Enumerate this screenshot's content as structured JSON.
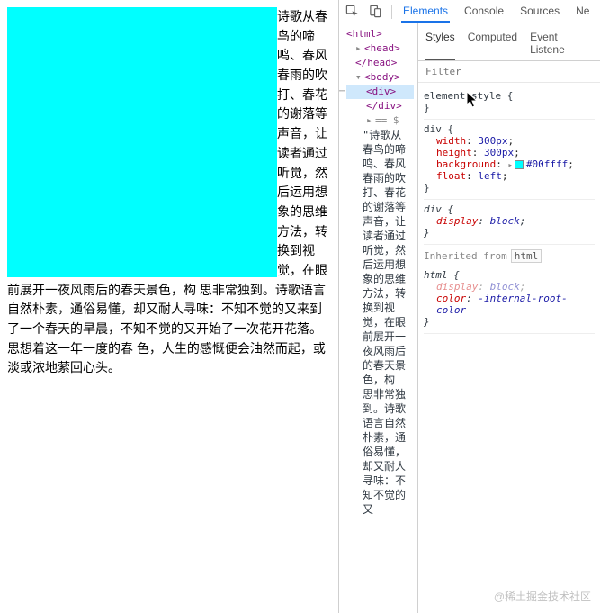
{
  "page": {
    "text": "诗歌从春鸟的啼鸣、春风春雨的吹打、春花的谢落等声音，让读者通过听觉，然后运用想象的思维方法，转换到视觉，在眼前展开一夜风雨后的春天景色，构 思非常独到。诗歌语言自然朴素，通俗易懂，却又耐人寻味：不知不觉的又来到 了一个春天的早晨，不知不觉的又开始了一次花开花落。思想着这一年一度的春 色，人生的感慨便会油然而起，或淡或浓地萦回心头。"
  },
  "toolbar": {
    "tabs": [
      "Elements",
      "Console",
      "Sources",
      "Ne"
    ]
  },
  "dom": {
    "lines": [
      "<html>",
      "<head>",
      "</head>",
      "<body>",
      "<div>",
      "</div>",
      "== $"
    ],
    "fulltext": "\"诗歌从春鸟的啼鸣、春风春雨的吹打、春花的谢落等声音，让读者通过听觉，然后运用想象的思维方法，转换到视觉，在眼前展开一夜风雨后的春天景色，构 思非常独到。诗歌语言自然朴素，通俗易懂，却又耐人寻味：不知不觉的又"
  },
  "styles": {
    "subtabs": [
      "Styles",
      "Computed",
      "Event Listene"
    ],
    "filter_placeholder": "Filter",
    "rules": {
      "element_style": "element.style {",
      "div1": {
        "selector": "div {",
        "width": {
          "name": "width",
          "value": "300px"
        },
        "height": {
          "name": "height",
          "value": "300px"
        },
        "background": {
          "name": "background",
          "value": "#00ffff"
        },
        "float": {
          "name": "float",
          "value": "left"
        }
      },
      "div2": {
        "selector": "div {",
        "display": {
          "name": "display",
          "value": "block"
        }
      },
      "inherited_label": "Inherited from",
      "inherited_from": "html",
      "html_rule": {
        "selector": "html {",
        "display": {
          "name": "display",
          "value": "block"
        },
        "color": {
          "name": "color",
          "value": "-internal-root-color"
        }
      }
    }
  },
  "watermark": "@稀土掘金技术社区"
}
